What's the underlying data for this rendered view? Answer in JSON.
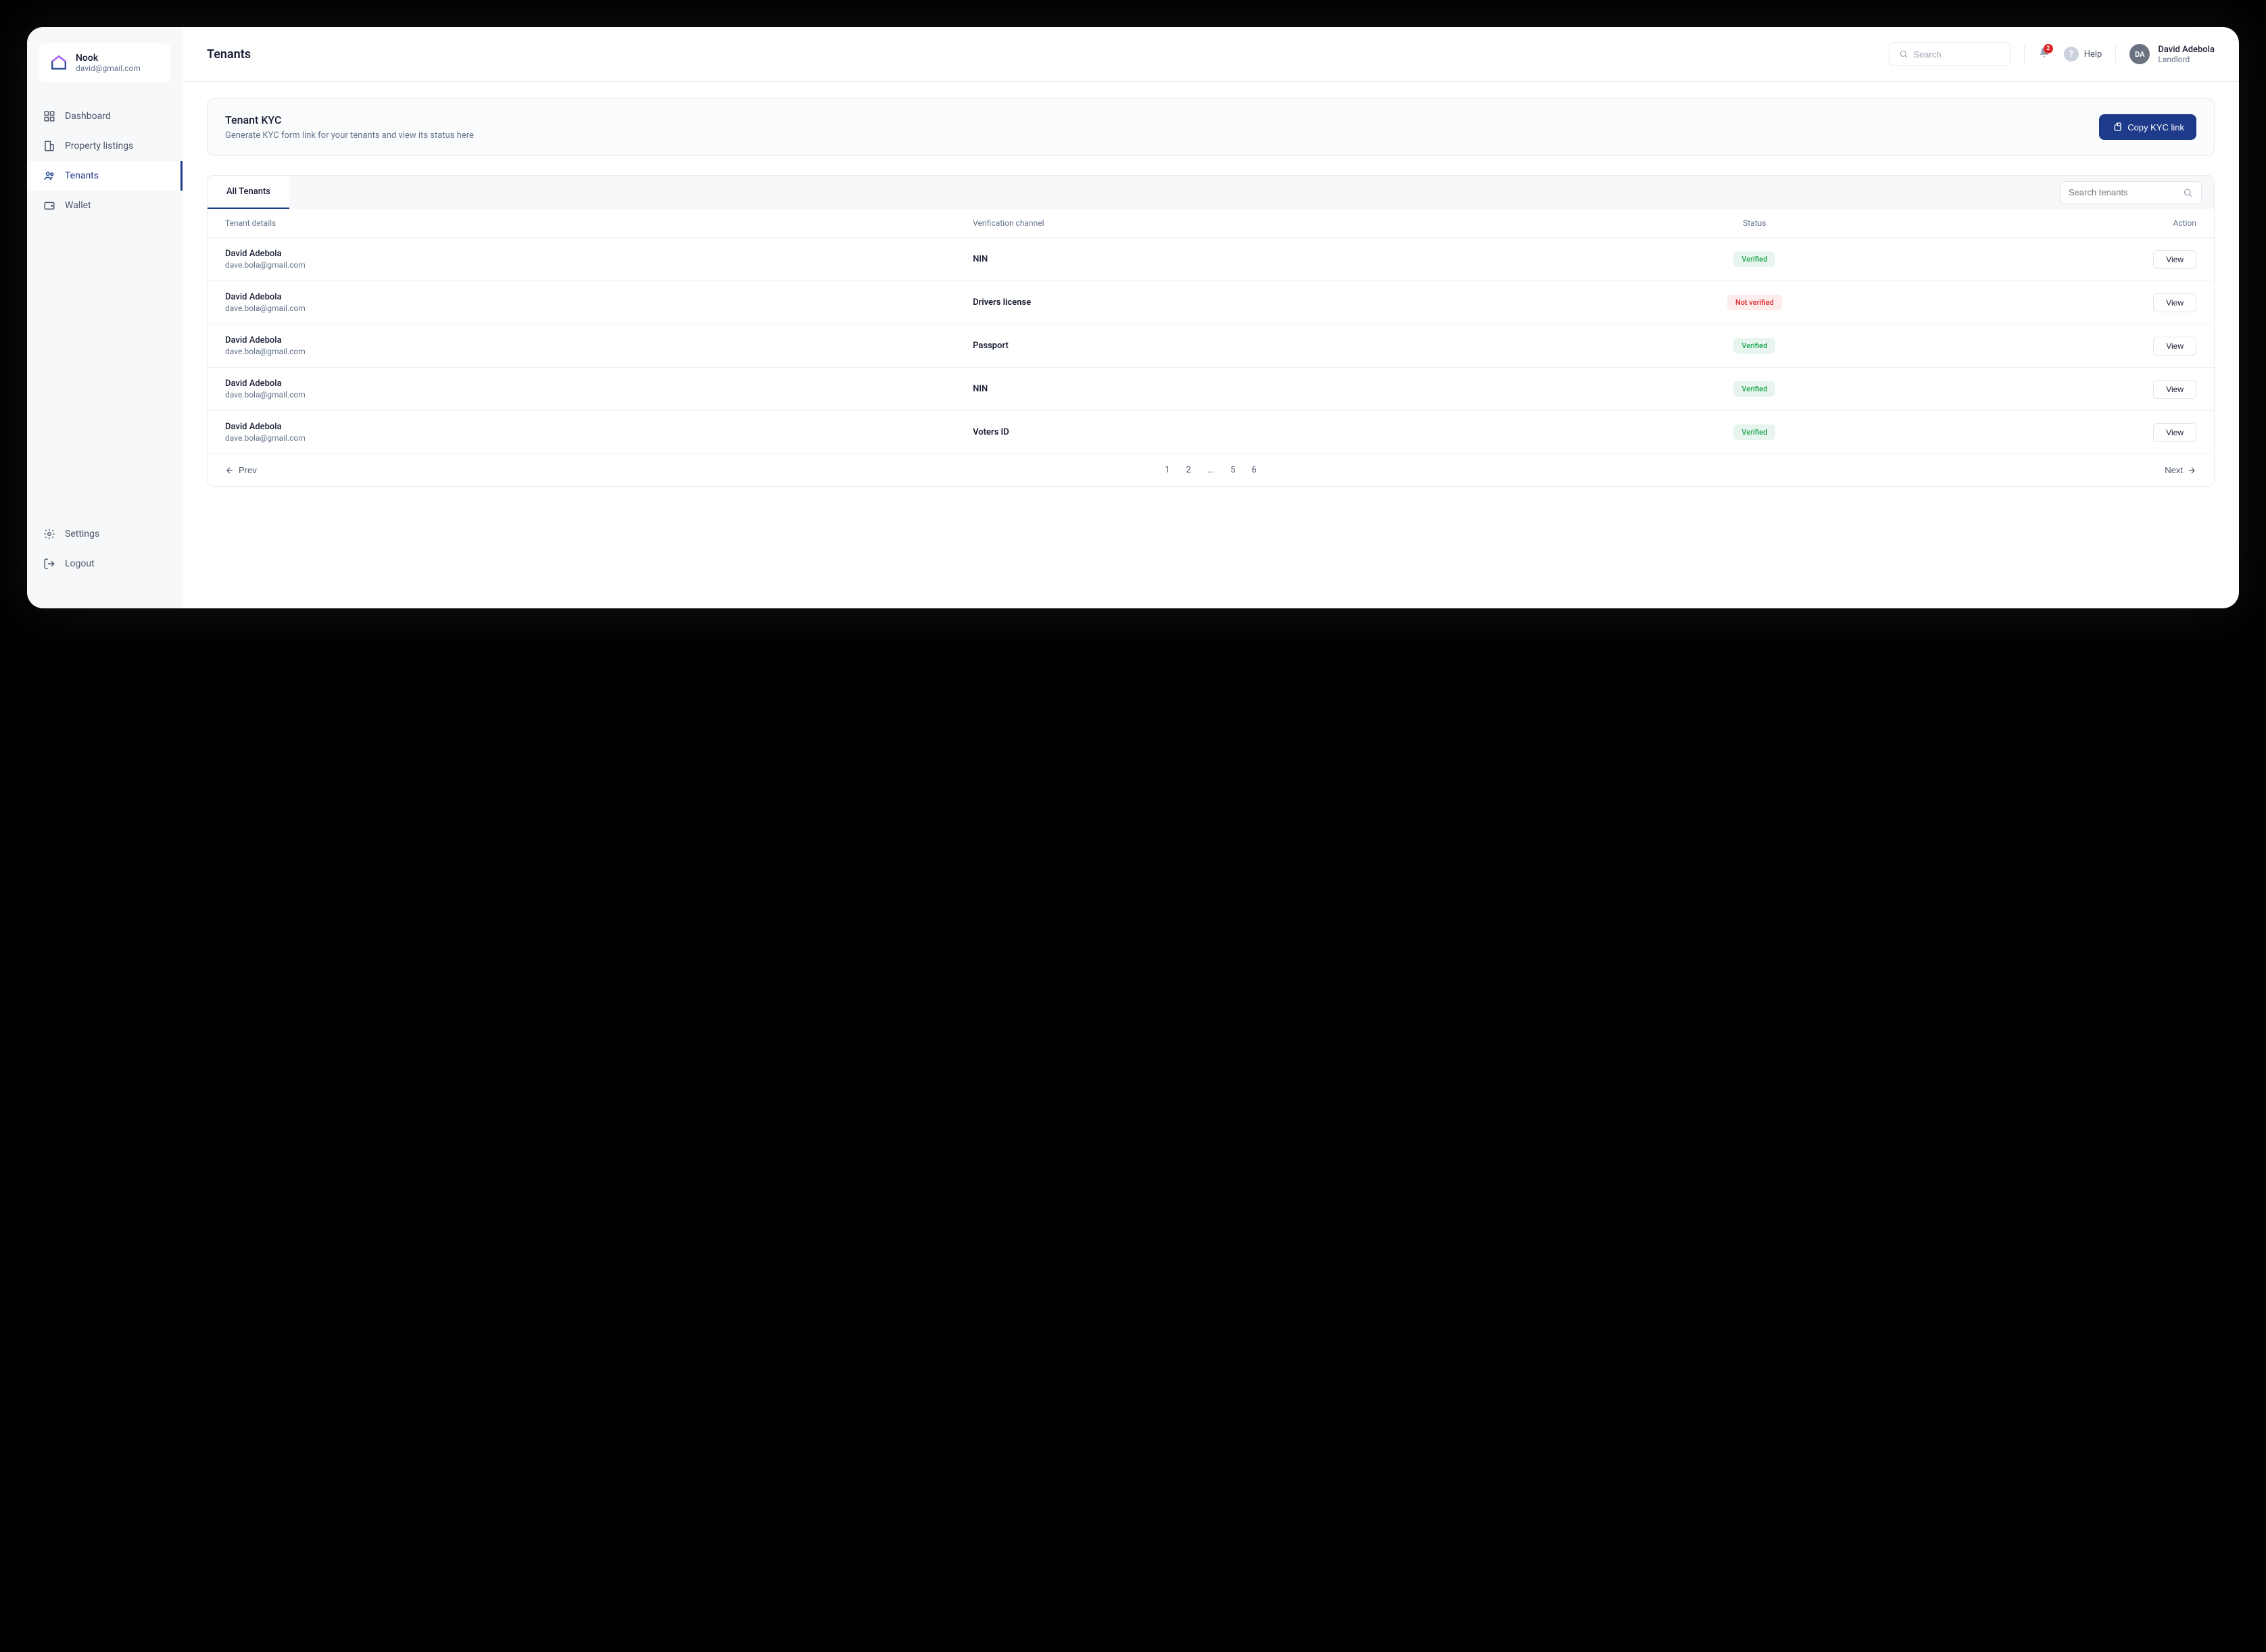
{
  "brand": {
    "name": "Nook",
    "email": "david@gmail.com"
  },
  "sidebar": {
    "items": [
      {
        "label": "Dashboard"
      },
      {
        "label": "Property listings"
      },
      {
        "label": "Tenants"
      },
      {
        "label": "Wallet"
      }
    ],
    "footer": [
      {
        "label": "Settings"
      },
      {
        "label": "Logout"
      }
    ]
  },
  "header": {
    "page_title": "Tenants",
    "search_placeholder": "Search",
    "notification_count": "2",
    "help_label": "Help",
    "avatar_initials": "DA",
    "user_name": "David Adebola",
    "user_role": "Landlord"
  },
  "kyc": {
    "title": "Tenant KYC",
    "subtitle": "Generate KYC form link for your tenants and view its status here",
    "button": "Copy KYC link"
  },
  "table": {
    "tab_label": "All Tenants",
    "search_placeholder": "Search tenants",
    "columns": {
      "tenant": "Tenant details",
      "channel": "Verification channel",
      "status": "Status",
      "action": "Action"
    },
    "action_label": "View",
    "status_labels": {
      "verified": "Verified",
      "not_verified": "Not verified"
    },
    "rows": [
      {
        "name": "David Adebola",
        "email": "dave.bola@gmail.com",
        "channel": "NIN",
        "status": "verified"
      },
      {
        "name": "David Adebola",
        "email": "dave.bola@gmail.com",
        "channel": "Drivers license",
        "status": "not_verified"
      },
      {
        "name": "David Adebola",
        "email": "dave.bola@gmail.com",
        "channel": "Passport",
        "status": "verified"
      },
      {
        "name": "David Adebola",
        "email": "dave.bola@gmail.com",
        "channel": "NIN",
        "status": "verified"
      },
      {
        "name": "David Adebola",
        "email": "dave.bola@gmail.com",
        "channel": "Voters ID",
        "status": "verified"
      }
    ]
  },
  "pagination": {
    "prev": "Prev",
    "next": "Next",
    "pages": [
      "1",
      "2",
      "...",
      "5",
      "6"
    ]
  }
}
